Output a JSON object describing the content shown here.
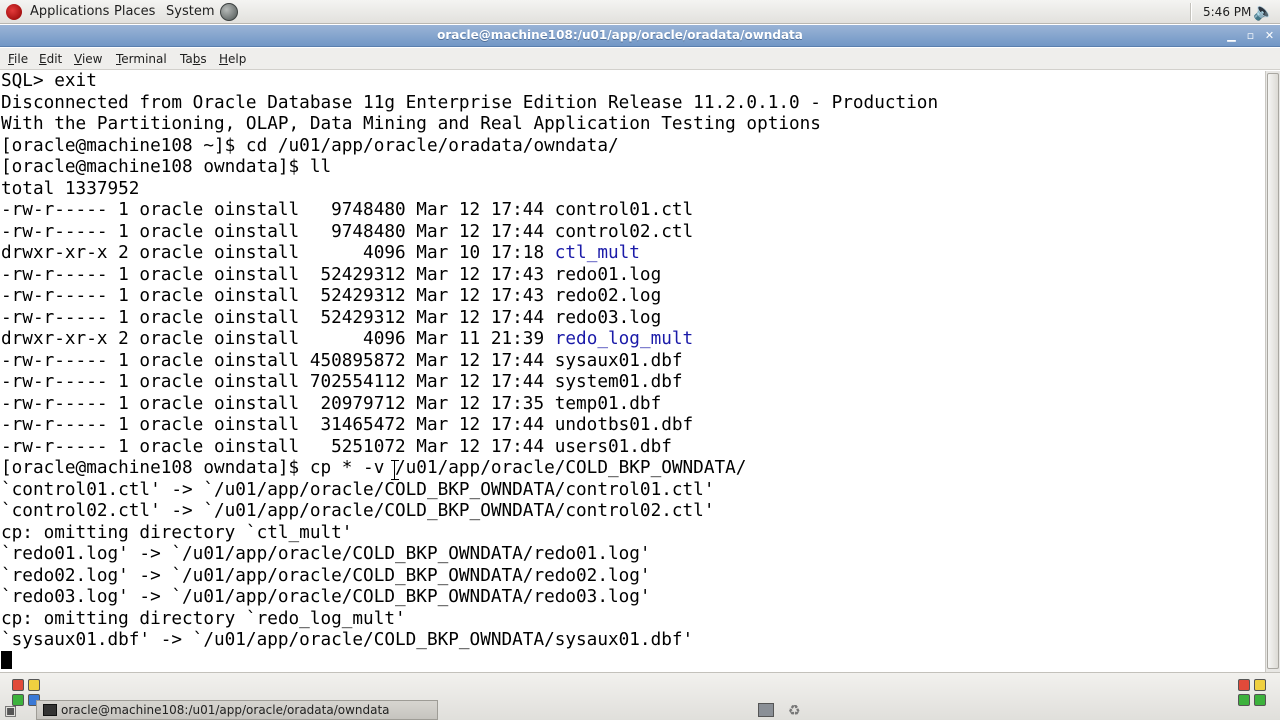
{
  "top_panel": {
    "applications": "Applications",
    "places": "Places",
    "system": "System",
    "clock": "5:46 PM"
  },
  "window": {
    "title": "oracle@machine108:/u01/app/oracle/oradata/owndata",
    "minimize": "▁",
    "maximize": "▫",
    "close": "✕"
  },
  "menubar": {
    "file": "ile",
    "file_key": "F",
    "edit": "dit",
    "edit_key": "E",
    "view": "iew",
    "view_key": "V",
    "terminal": "erminal",
    "terminal_key": "T",
    "tabs": "Ta",
    "tabs_key": "b",
    "tabs_rest": "s",
    "help": "elp",
    "help_key": "H"
  },
  "terminal": {
    "lines": [
      "SQL> exit",
      "Disconnected from Oracle Database 11g Enterprise Edition Release 11.2.0.1.0 - Production",
      "With the Partitioning, OLAP, Data Mining and Real Application Testing options",
      "[oracle@machine108 ~]$ cd /u01/app/oracle/oradata/owndata/",
      "[oracle@machine108 owndata]$ ll",
      "total 1337952",
      "-rw-r----- 1 oracle oinstall   9748480 Mar 12 17:44 control01.ctl",
      "-rw-r----- 1 oracle oinstall   9748480 Mar 12 17:44 control02.ctl",
      "drwxr-xr-x 2 oracle oinstall      4096 Mar 10 17:18 ",
      "-rw-r----- 1 oracle oinstall  52429312 Mar 12 17:43 redo01.log",
      "-rw-r----- 1 oracle oinstall  52429312 Mar 12 17:43 redo02.log",
      "-rw-r----- 1 oracle oinstall  52429312 Mar 12 17:44 redo03.log",
      "drwxr-xr-x 2 oracle oinstall      4096 Mar 11 21:39 ",
      "-rw-r----- 1 oracle oinstall 450895872 Mar 12 17:44 sysaux01.dbf",
      "-rw-r----- 1 oracle oinstall 702554112 Mar 12 17:44 system01.dbf",
      "-rw-r----- 1 oracle oinstall  20979712 Mar 12 17:35 temp01.dbf",
      "-rw-r----- 1 oracle oinstall  31465472 Mar 12 17:44 undotbs01.dbf",
      "-rw-r----- 1 oracle oinstall   5251072 Mar 12 17:44 users01.dbf",
      "[oracle@machine108 owndata]$ cp * -v /u01/app/oracle/COLD_BKP_OWNDATA/",
      "`control01.ctl' -> `/u01/app/oracle/COLD_BKP_OWNDATA/control01.ctl'",
      "`control02.ctl' -> `/u01/app/oracle/COLD_BKP_OWNDATA/control02.ctl'",
      "cp: omitting directory `ctl_mult'",
      "`redo01.log' -> `/u01/app/oracle/COLD_BKP_OWNDATA/redo01.log'",
      "`redo02.log' -> `/u01/app/oracle/COLD_BKP_OWNDATA/redo02.log'",
      "`redo03.log' -> `/u01/app/oracle/COLD_BKP_OWNDATA/redo03.log'",
      "cp: omitting directory `redo_log_mult'",
      "`sysaux01.dbf' -> `/u01/app/oracle/COLD_BKP_OWNDATA/sysaux01.dbf'"
    ],
    "dir_entries": [
      "ctl_mult",
      "redo_log_mult"
    ],
    "dir_color": "#1a1aa8"
  },
  "taskbar": {
    "window_label": "oracle@machine108:/u01/app/oracle/oradata/owndata"
  },
  "icons": {
    "distro": "redhat-logo-icon",
    "network": "network-globe-icon",
    "volume": "speaker-icon",
    "show_desktop": "show-desktop-icon",
    "terminal": "terminal-icon"
  }
}
